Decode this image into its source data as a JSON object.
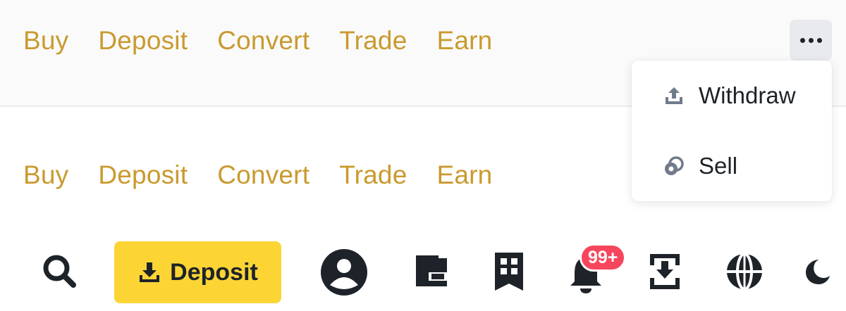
{
  "nav_links_top": [
    "Buy",
    "Deposit",
    "Convert",
    "Trade",
    "Earn"
  ],
  "nav_links_bottom": [
    "Buy",
    "Deposit",
    "Convert",
    "Trade",
    "Earn"
  ],
  "more_menu": {
    "items": [
      {
        "label": "Withdraw",
        "icon": "upload-icon"
      },
      {
        "label": "Sell",
        "icon": "sell-icon"
      }
    ]
  },
  "toolbar": {
    "deposit_label": "Deposit",
    "notification_badge": "99+"
  },
  "colors": {
    "link": "#c99a2e",
    "accent": "#fcd535",
    "badge": "#f6465d",
    "icon": "#1e2329"
  }
}
